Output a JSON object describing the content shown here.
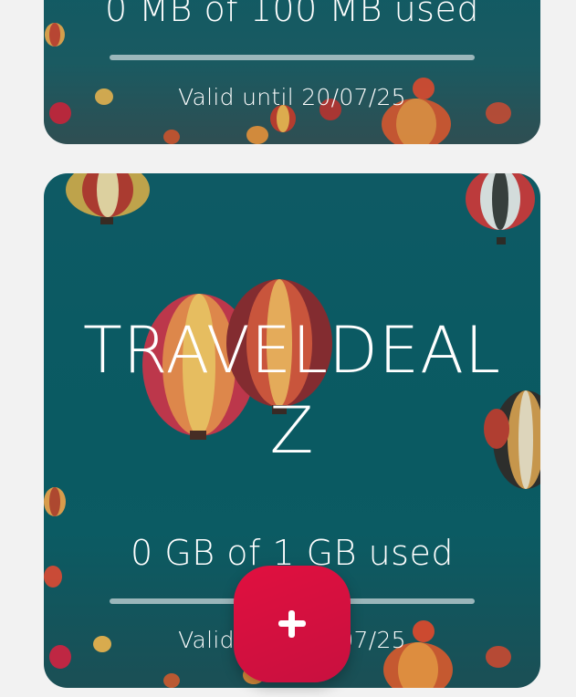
{
  "plans": [
    {
      "name": "",
      "usage_text": "0 MB of 100 MB used",
      "usage_fraction": 0,
      "valid_text": "Valid until 20/07/25"
    },
    {
      "name": "TRAVELDEALZ",
      "usage_text": "0 GB of 1 GB used",
      "usage_fraction": 0,
      "valid_text": "Valid until 20/07/25"
    }
  ],
  "fab": {
    "icon": "plus-icon"
  },
  "colors": {
    "card_background": "#0b5a63",
    "fab_accent": "#d90f42",
    "page_background": "#f2f2f2"
  }
}
